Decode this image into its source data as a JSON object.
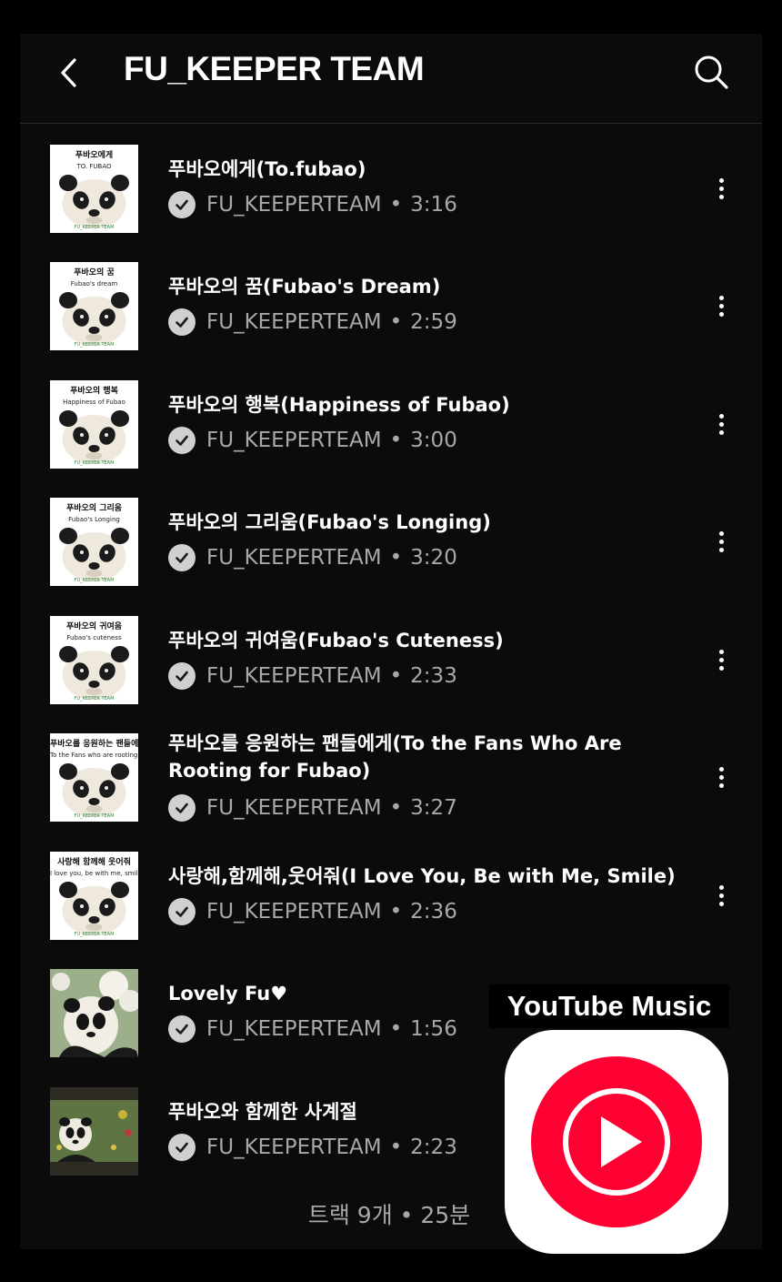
{
  "header": {
    "title": "FU_KEEPER TEAM"
  },
  "tracks": [
    {
      "title": "푸바오에게(To.fubao)",
      "artist": "FU_KEEPERTEAM",
      "duration": "3:16",
      "thumb_title": "푸바오에게",
      "thumb_sub": "TO. FUBAO",
      "thumb_type": "panda"
    },
    {
      "title": "푸바오의 꿈(Fubao's Dream)",
      "artist": "FU_KEEPERTEAM",
      "duration": "2:59",
      "thumb_title": "푸바오의 꿈",
      "thumb_sub": "Fubao's dream",
      "thumb_type": "panda"
    },
    {
      "title": "푸바오의 행복(Happiness of Fubao)",
      "artist": "FU_KEEPERTEAM",
      "duration": "3:00",
      "thumb_title": "푸바오의 행복",
      "thumb_sub": "Happiness of Fubao",
      "thumb_type": "panda"
    },
    {
      "title": "푸바오의 그리움(Fubao's Longing)",
      "artist": "FU_KEEPERTEAM",
      "duration": "3:20",
      "thumb_title": "푸바오의 그리움",
      "thumb_sub": "Fubao's Longing",
      "thumb_type": "panda"
    },
    {
      "title": "푸바오의 귀여움(Fubao's Cuteness)",
      "artist": "FU_KEEPERTEAM",
      "duration": "2:33",
      "thumb_title": "푸바오의 귀여움",
      "thumb_sub": "Fubao's cuteness",
      "thumb_type": "panda"
    },
    {
      "title": "푸바오를 응원하는 팬들에게(To the Fans Who Are Rooting for Fubao)",
      "artist": "FU_KEEPERTEAM",
      "duration": "3:27",
      "thumb_title": "푸바오를 응원하는 팬들에게",
      "thumb_sub": "To the Fans who are rooting for Fubao",
      "thumb_type": "panda"
    },
    {
      "title": "사랑해,함께해,웃어줘(I Love You, Be with Me, Smile)",
      "artist": "FU_KEEPERTEAM",
      "duration": "2:36",
      "thumb_title": "사랑해 함께해 웃어줘",
      "thumb_sub": "I love you, be with me, smile",
      "thumb_type": "panda"
    },
    {
      "title": "Lovely Fu♥",
      "artist": "FU_KEEPERTEAM",
      "duration": "1:56",
      "thumb_title": "",
      "thumb_sub": "",
      "thumb_type": "photo-blossom"
    },
    {
      "title": "푸바오와 함께한 사계절",
      "artist": "FU_KEEPERTEAM",
      "duration": "2:23",
      "thumb_title": "",
      "thumb_sub": "",
      "thumb_type": "photo-field"
    }
  ],
  "summary": "트랙 9개 • 25분",
  "overlay": {
    "label": "YouTube Music",
    "accent": "#ff0033"
  },
  "icons": [
    "back-icon",
    "search-icon",
    "verified-check-icon",
    "more-vert-icon",
    "youtube-music-logo"
  ]
}
